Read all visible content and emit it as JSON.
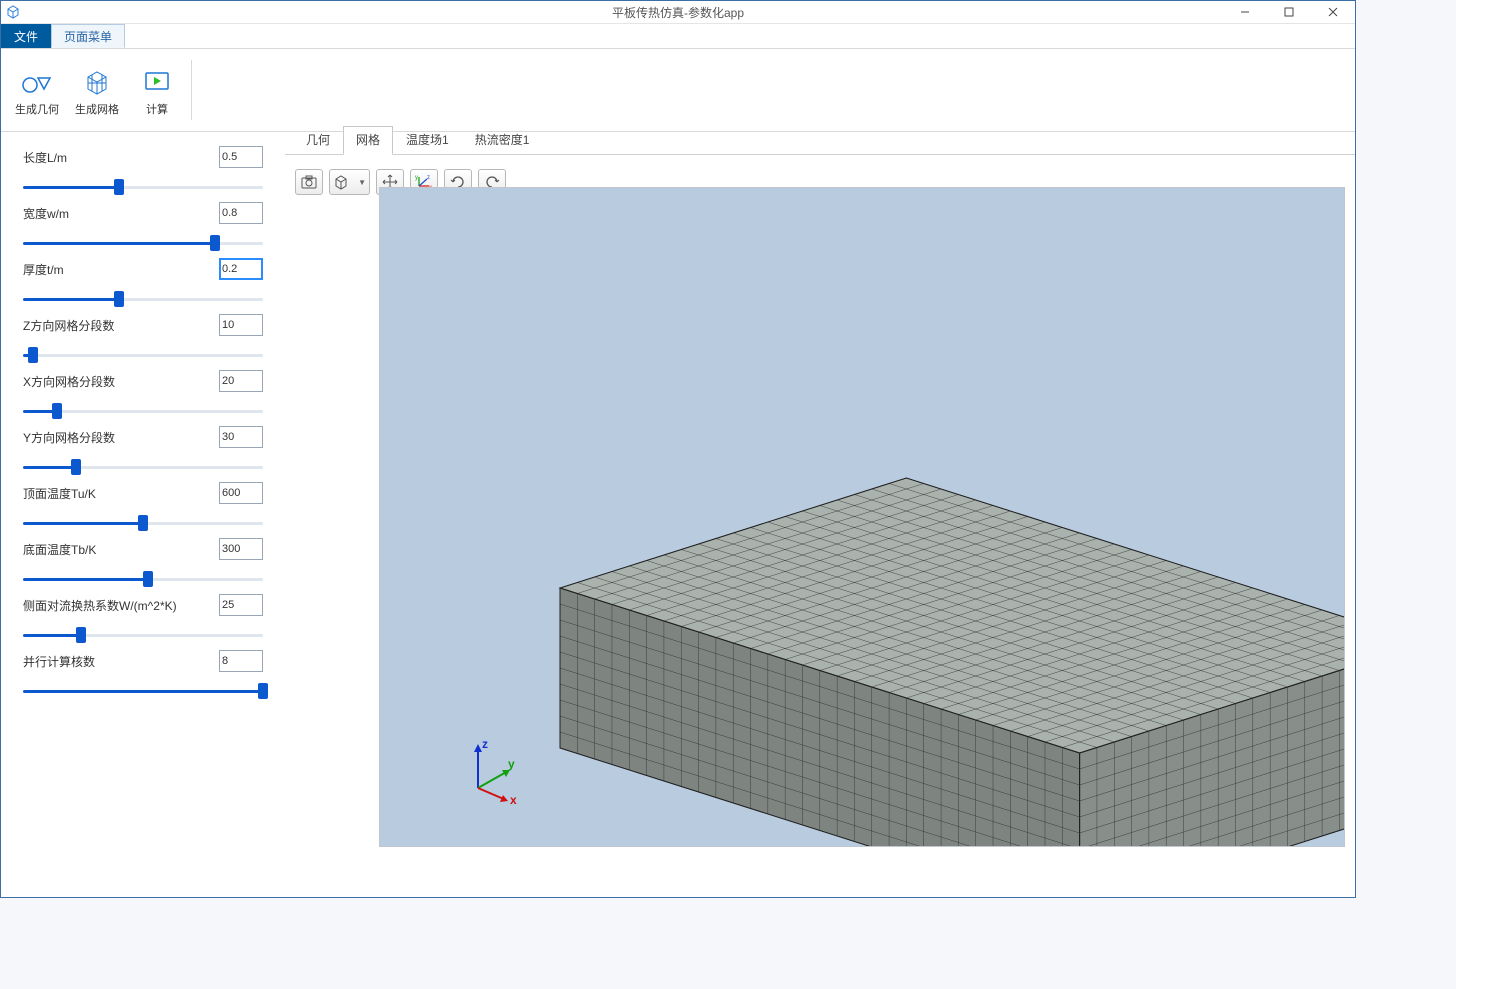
{
  "window": {
    "title": "平板传热仿真-参数化app"
  },
  "menus": {
    "file": "文件",
    "page": "页面菜单"
  },
  "ribbon": {
    "gen_geom": "生成几何",
    "gen_mesh": "生成网格",
    "compute": "计算"
  },
  "tabs": [
    "几何",
    "网格",
    "温度场1",
    "热流密度1"
  ],
  "active_tab_index": 1,
  "params": [
    {
      "label": "长度L/m",
      "value": "0.5",
      "pos": 40,
      "focused": false
    },
    {
      "label": "宽度w/m",
      "value": "0.8",
      "pos": 80,
      "focused": false
    },
    {
      "label": "厚度t/m",
      "value": "0.2",
      "pos": 40,
      "focused": true
    },
    {
      "label": "Z方向网格分段数",
      "value": "10",
      "pos": 4,
      "focused": false
    },
    {
      "label": "X方向网格分段数",
      "value": "20",
      "pos": 14,
      "focused": false
    },
    {
      "label": "Y方向网格分段数",
      "value": "30",
      "pos": 22,
      "focused": false
    },
    {
      "label": "顶面温度Tu/K",
      "value": "600",
      "pos": 50,
      "focused": false
    },
    {
      "label": "底面温度Tb/K",
      "value": "300",
      "pos": 52,
      "focused": false
    },
    {
      "label": "侧面对流换热系数W/(m^2*K)",
      "value": "25",
      "pos": 24,
      "focused": false
    },
    {
      "label": "并行计算核数",
      "value": "8",
      "pos": 100,
      "focused": false
    }
  ],
  "mesh": {
    "nx": 30,
    "ny": 20,
    "nz": 10
  },
  "axis": {
    "labels": {
      "x": "x",
      "y": "y",
      "z": "z"
    }
  },
  "view_tools": [
    "camera",
    "box-view",
    "pan",
    "xyz",
    "rotate-cw",
    "rotate-ccw"
  ]
}
